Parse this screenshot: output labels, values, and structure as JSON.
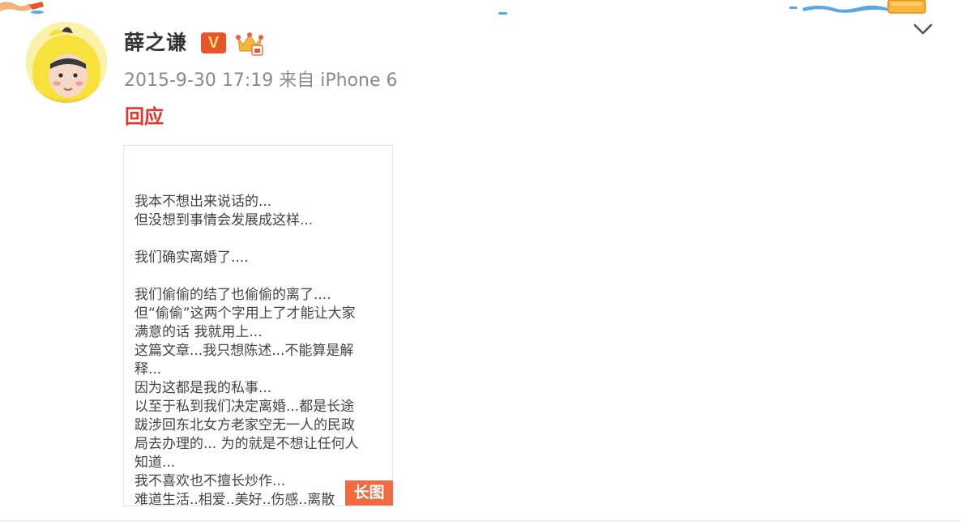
{
  "post": {
    "author": "薛之谦",
    "verified_badge": "V",
    "crown_icon": "crown-badge-icon",
    "timestamp_and_source": "2015-9-30 17:19 来自 iPhone 6",
    "text": "回应",
    "menu_icon": "chevron-down-icon"
  },
  "long_image": {
    "badge": "长图",
    "lines": [
      "我本不想出来说话的...",
      "但没想到事情会发展成这样...",
      "",
      "我们确实离婚了....",
      "",
      "我们偷偷的结了也偷偷的离了....",
      "但“偷偷”这两个字用上了才能让大家",
      "满意的话 我就用上...",
      "这篇文章...我只想陈述...不能算是解",
      "释...",
      "因为这都是我的私事...",
      "以至于私到我们决定离婚...都是长途",
      "跋涉回东北女方老家空无一人的民政",
      "局去办理的... 为的就是不想让任何人",
      "知道...",
      "我不喜欢也不擅长炒作...",
      "难道生活..相爱..美好..伤感..离散"
    ]
  },
  "colors": {
    "accent_red": "#e8332b",
    "badge_orange": "#f06a42",
    "meta_gray": "#8a8a8a",
    "avatar_yellow": "#f6e23a"
  }
}
